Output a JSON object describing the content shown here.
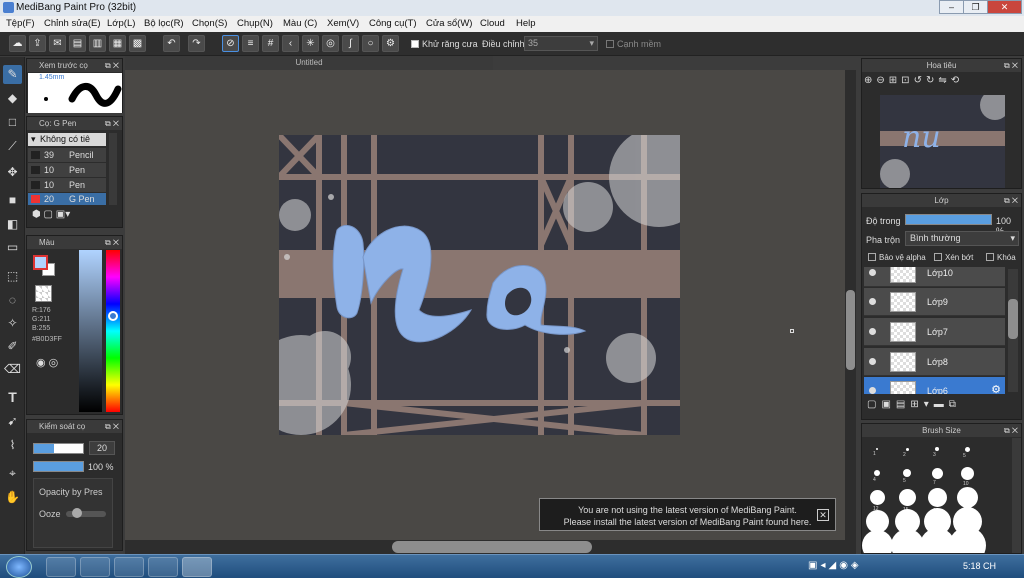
{
  "window": {
    "title": "MediBang Paint Pro (32bit)",
    "min": "–",
    "max": "❐",
    "close": "✕"
  },
  "menu": [
    "Tệp(F)",
    "Chỉnh sửa(E)",
    "Lớp(L)",
    "Bộ lọc(R)",
    "Chọn(S)",
    "Chụp(N)",
    "Màu (C)",
    "Xem(V)",
    "Công cụ(T)",
    "Cửa sổ(W)",
    "Cloud",
    "Help"
  ],
  "toolbar": {
    "antialias_label": "Khử răng cưa",
    "adjust_label": "Điều chỉnh",
    "adjust_value": "35",
    "smooth_label": "Cạnh mềm"
  },
  "document": {
    "tab_title": "Untitled"
  },
  "brush_preview": {
    "title": "Xem trước cọ",
    "size": "1.45mm"
  },
  "brush_panel": {
    "title": "Cọ: G Pen",
    "group": "Không có tiê",
    "items": [
      {
        "size": "39",
        "name": "Pencil"
      },
      {
        "size": "10",
        "name": "Pen"
      },
      {
        "size": "10",
        "name": "Pen (Sha"
      },
      {
        "size": "20",
        "name": "G Pen"
      }
    ]
  },
  "color_panel": {
    "title": "Màu",
    "r": "R:176",
    "g": "G:211",
    "b": "B:255",
    "hex": "#B0D3FF",
    "fg": "#B0D3FF",
    "bg": "#ffffff"
  },
  "brush_control": {
    "title": "Kiểm soát cọ",
    "size": "20",
    "opacity": "100 %",
    "opt1": "Opacity by Pres",
    "opt2": "Ooze"
  },
  "navigator": {
    "title": "Hoa tiêu"
  },
  "layers": {
    "title": "Lớp",
    "opacity_label": "Độ trong",
    "opacity_value": "100 %",
    "blend_label": "Pha trộn",
    "blend_value": "Bình thường",
    "protect_alpha": "Bảo vệ alpha",
    "clipping": "Xén bớt",
    "lock": "Khóa",
    "items": [
      "Lớp10",
      "Lớp9",
      "Lớp7",
      "Lớp8",
      "Lớp6"
    ]
  },
  "brush_size": {
    "title": "Brush Size",
    "rows": [
      [
        "1",
        "2",
        "3",
        "5"
      ],
      [
        "4",
        "5",
        "7",
        "10"
      ],
      [
        "12",
        "15",
        "20",
        "25"
      ],
      [
        "30",
        "40",
        "50",
        "70"
      ],
      [
        "60",
        "80",
        "100",
        "150"
      ]
    ]
  },
  "notice": {
    "line1": "You are not using the latest version of MediBang Paint.",
    "line2": "Please install the latest version of MediBang Paint found here.",
    "close": "✕"
  },
  "taskbar": {
    "time": "5:18 CH"
  }
}
